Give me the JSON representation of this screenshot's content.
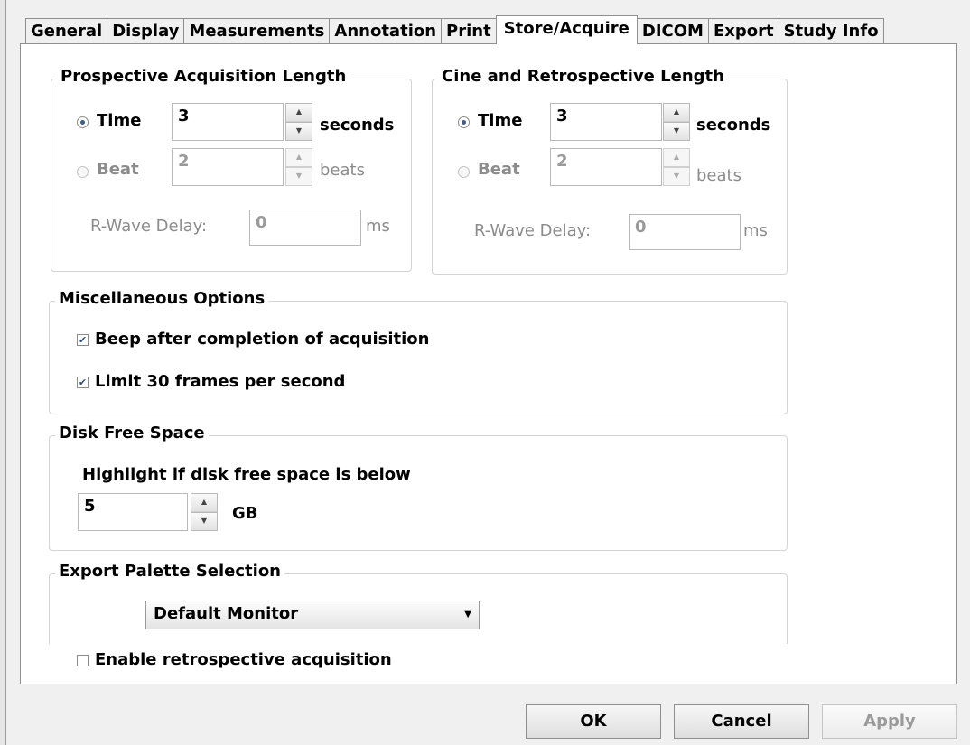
{
  "tabs": [
    "General",
    "Display",
    "Measurements",
    "Annotation",
    "Print",
    "Store/Acquire",
    "DICOM",
    "Export",
    "Study Info"
  ],
  "active_tab": "Store/Acquire",
  "prospective": {
    "title": "Prospective Acquisition Length",
    "time_label": "Time",
    "time_value": "3",
    "time_unit": "seconds",
    "beat_label": "Beat",
    "beat_value": "2",
    "beat_unit": "beats",
    "rwave_label": "R-Wave Delay:",
    "rwave_value": "0",
    "rwave_unit": "ms"
  },
  "cine": {
    "title": "Cine and Retrospective Length",
    "time_label": "Time",
    "time_value": "3",
    "time_unit": "seconds",
    "beat_label": "Beat",
    "beat_value": "2",
    "beat_unit": "beats",
    "rwave_label": "R-Wave Delay:",
    "rwave_value": "0",
    "rwave_unit": "ms"
  },
  "misc": {
    "title": "Miscellaneous Options",
    "beep_label": "Beep after completion of acquisition",
    "limit_label": "Limit 30 frames per second"
  },
  "disk": {
    "title": "Disk Free Space",
    "highlight_label": "Highlight if disk free space is below",
    "value": "5",
    "unit": "GB"
  },
  "export_palette": {
    "title": "Export Palette Selection",
    "selected": "Default Monitor"
  },
  "retro_label": "Enable retrospective acquisition",
  "buttons": {
    "ok": "OK",
    "cancel": "Cancel",
    "apply": "Apply"
  }
}
